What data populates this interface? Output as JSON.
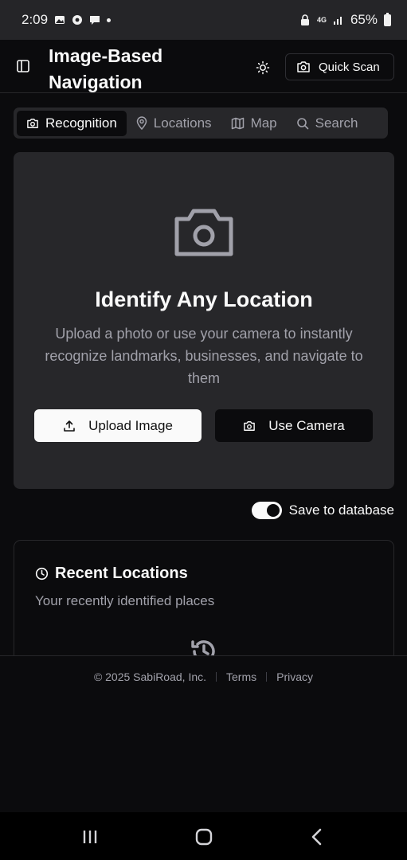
{
  "status_bar": {
    "time": "2:09",
    "network": "4G",
    "battery": "65%"
  },
  "header": {
    "title": "Image-Based Navigation",
    "quick_scan_label": "Quick Scan"
  },
  "tabs": [
    {
      "label": "Recognition",
      "icon": "camera-icon",
      "active": true
    },
    {
      "label": "Locations",
      "icon": "map-pin-icon",
      "active": false
    },
    {
      "label": "Map",
      "icon": "map-icon",
      "active": false
    },
    {
      "label": "Search",
      "icon": "search-icon",
      "active": false
    }
  ],
  "hero": {
    "title": "Identify Any Location",
    "description": "Upload a photo or use your camera to instantly recognize landmarks, businesses, and navigate to them",
    "upload_label": "Upload Image",
    "camera_label": "Use Camera"
  },
  "save_toggle": {
    "label": "Save to database",
    "checked": true
  },
  "recent": {
    "title": "Recent Locations",
    "subtitle": "Your recently identified places"
  },
  "footer": {
    "copyright": "© 2025 SabiRoad, Inc.",
    "terms": "Terms",
    "privacy": "Privacy"
  },
  "colors": {
    "background": "#0b0b0d",
    "card": "#27272a",
    "muted_text": "#a1a1aa",
    "foreground": "#fafafa"
  }
}
